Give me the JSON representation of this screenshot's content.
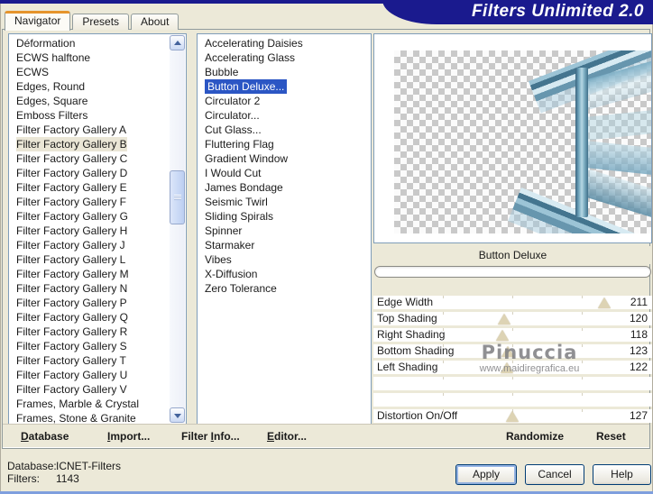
{
  "window": {
    "title": "Filters Unlimited 2.0"
  },
  "tabs": [
    {
      "label": "Navigator",
      "active": true
    },
    {
      "label": "Presets",
      "active": false
    },
    {
      "label": "About",
      "active": false
    }
  ],
  "category_list": {
    "selected_index": 7,
    "items": [
      "Déformation",
      "ECWS halftone",
      "ECWS",
      "Edges, Round",
      "Edges, Square",
      "Emboss Filters",
      "Filter Factory Gallery A",
      "Filter Factory Gallery B",
      "Filter Factory Gallery C",
      "Filter Factory Gallery D",
      "Filter Factory Gallery E",
      "Filter Factory Gallery F",
      "Filter Factory Gallery G",
      "Filter Factory Gallery H",
      "Filter Factory Gallery J",
      "Filter Factory Gallery L",
      "Filter Factory Gallery M",
      "Filter Factory Gallery N",
      "Filter Factory Gallery P",
      "Filter Factory Gallery Q",
      "Filter Factory Gallery R",
      "Filter Factory Gallery S",
      "Filter Factory Gallery T",
      "Filter Factory Gallery U",
      "Filter Factory Gallery V",
      "Frames, Marble & Crystal",
      "Frames, Stone & Granite"
    ]
  },
  "filter_list": {
    "selected_index": 3,
    "items": [
      "Accelerating Daisies",
      "Accelerating Glass",
      "Bubble",
      "Button Deluxe...",
      "Circulator 2",
      "Circulator...",
      "Cut Glass...",
      "Fluttering Flag",
      "Gradient Window",
      "I Would Cut",
      "James Bondage",
      "Seismic Twirl",
      "Sliding Spirals",
      "Spinner",
      "Starmaker",
      "Vibes",
      "X-Diffusion",
      "Zero Tolerance"
    ]
  },
  "preview": {
    "filter_name": "Button Deluxe"
  },
  "slider_max": 255,
  "sliders": [
    {
      "label": "Edge Width",
      "value": 211
    },
    {
      "label": "Top Shading",
      "value": 120
    },
    {
      "label": "Right Shading",
      "value": 118
    },
    {
      "label": "Bottom Shading",
      "value": 123
    },
    {
      "label": "Left Shading",
      "value": 122
    },
    {
      "label": "",
      "value": null
    },
    {
      "label": "",
      "value": null
    },
    {
      "label": "Distortion On/Off",
      "value": 127
    }
  ],
  "watermark": {
    "line1": "Pinuccia",
    "line2": "www.maidiregrafica.eu"
  },
  "toolbar": {
    "database": {
      "label": "Database",
      "mnemonic": 0
    },
    "import": {
      "label": "Import...",
      "mnemonic": 0
    },
    "filter_info": {
      "label": "Filter Info...",
      "mnemonic": 7
    },
    "editor": {
      "label": "Editor...",
      "mnemonic": 0
    },
    "randomize": "Randomize",
    "reset": "Reset"
  },
  "status": {
    "database_label": "Database:",
    "database_value": "ICNET-Filters",
    "filters_label": "Filters:",
    "filters_value": "1143"
  },
  "buttons": {
    "apply": "Apply",
    "cancel": "Cancel",
    "help": "Help"
  },
  "colors": {
    "banner_navy": "#1a1a8e",
    "selection_blue": "#2b56c4",
    "category_highlight": "#eae6d6",
    "window_beige": "#ece9d8",
    "slider_thumb": "#ddd3b4",
    "active_tab_orange": "#e5942c"
  }
}
